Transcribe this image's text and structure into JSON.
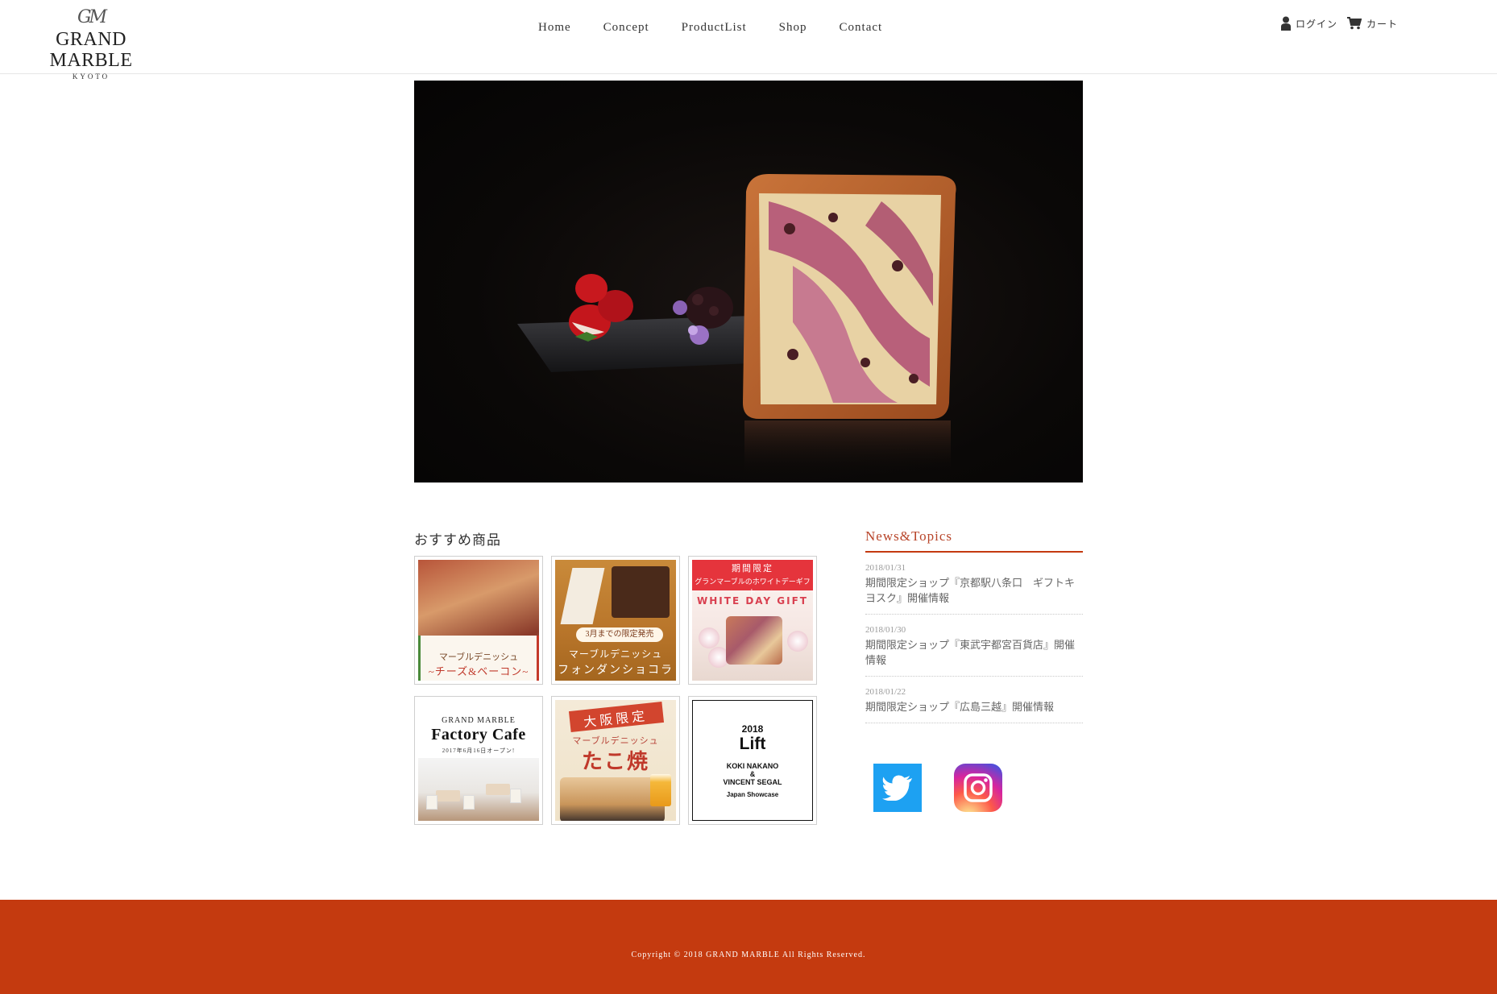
{
  "header": {
    "logo": {
      "mark": "GM",
      "name": "GRAND MARBLE",
      "sub": "KYOTO"
    },
    "nav": [
      {
        "label": "Home"
      },
      {
        "label": "Concept"
      },
      {
        "label": "ProductList"
      },
      {
        "label": "Shop"
      },
      {
        "label": "Contact"
      }
    ],
    "account": {
      "login_label": "ログイン",
      "cart_label": "カート"
    }
  },
  "recommended": {
    "title": "おすすめ商品",
    "tiles": [
      {
        "line1": "マーブルデニッシュ",
        "line2": "~チーズ&ベーコン~"
      },
      {
        "badge": "3月までの限定発売",
        "line1": "マーブルデニッシュ",
        "line2": "フォンダンショコラ"
      },
      {
        "line1": "期間限定",
        "line2": "グランマーブルのホワイトデーギフト",
        "line3": "WHITE DAY GIFT"
      },
      {
        "line1": "GRAND MARBLE",
        "line2": "Factory Cafe",
        "line3": "2017年6月16日オープン!"
      },
      {
        "line1": "大阪限定",
        "line2": "マーブルデニッシュ",
        "line3": "たこ焼"
      },
      {
        "line1": "2018",
        "line2": "Lift",
        "line3": "KOKI NAKANO",
        "line4": "&",
        "line5": "VINCENT SEGAL",
        "line6": "Japan Showcase"
      }
    ]
  },
  "news": {
    "title": "News&Topics",
    "items": [
      {
        "date": "2018/01/31",
        "text": "期間限定ショップ『京都駅八条口　ギフトキヨスク』開催情報"
      },
      {
        "date": "2018/01/30",
        "text": "期間限定ショップ『東武宇都宮百貨店』開催情報"
      },
      {
        "date": "2018/01/22",
        "text": "期間限定ショップ『広島三越』開催情報"
      }
    ]
  },
  "social": {
    "twitter_icon": "twitter-icon",
    "instagram_icon": "instagram-icon"
  },
  "footer": {
    "copyright": "Copyright ©   2018 GRAND MARBLE All Rights Reserved."
  },
  "colors": {
    "accent": "#c43a0f",
    "news_title": "#b8452a",
    "twitter": "#1da1f2"
  }
}
